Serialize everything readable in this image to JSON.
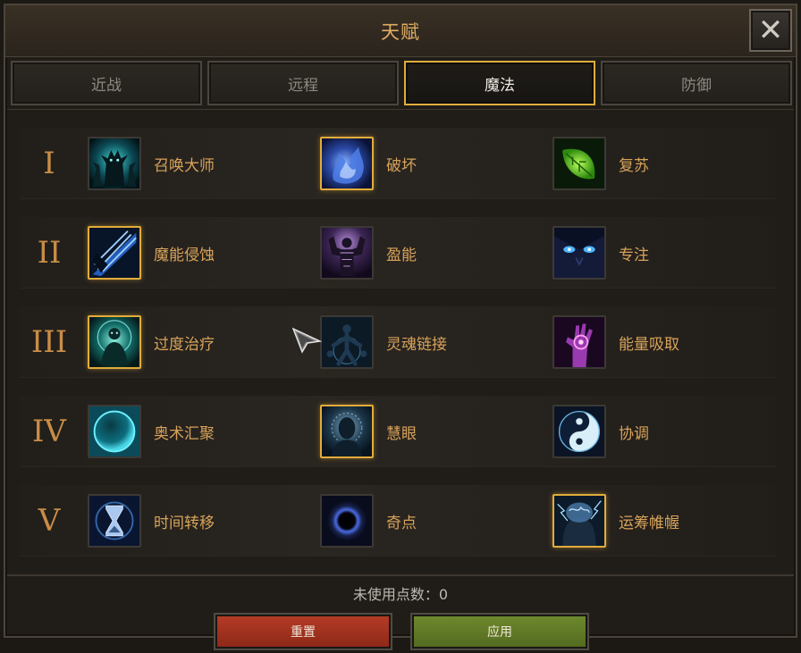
{
  "window": {
    "title": "天赋",
    "close_icon": "close-icon"
  },
  "tabs": [
    {
      "label": "近战",
      "active": false
    },
    {
      "label": "远程",
      "active": false
    },
    {
      "label": "魔法",
      "active": true
    },
    {
      "label": "防御",
      "active": false
    }
  ],
  "tiers": [
    {
      "label": "I",
      "talents": [
        {
          "name": "召唤大师",
          "icon": "demon-summon-icon",
          "selected": false
        },
        {
          "name": "破坏",
          "icon": "blue-flame-icon",
          "selected": true
        },
        {
          "name": "复苏",
          "icon": "green-leaf-icon",
          "selected": false
        }
      ]
    },
    {
      "label": "II",
      "talents": [
        {
          "name": "魔能侵蚀",
          "icon": "arcane-slash-icon",
          "selected": true
        },
        {
          "name": "盈能",
          "icon": "flexing-figure-icon",
          "selected": false
        },
        {
          "name": "专注",
          "icon": "glowing-eyes-icon",
          "selected": false
        }
      ]
    },
    {
      "label": "III",
      "talents": [
        {
          "name": "过度治疗",
          "icon": "healing-aura-icon",
          "selected": true
        },
        {
          "name": "灵魂链接",
          "icon": "soul-link-icon",
          "selected": false
        },
        {
          "name": "能量吸取",
          "icon": "drain-hand-icon",
          "selected": false
        }
      ]
    },
    {
      "label": "IV",
      "talents": [
        {
          "name": "奥术汇聚",
          "icon": "arcane-orb-icon",
          "selected": false
        },
        {
          "name": "慧眼",
          "icon": "enlightened-head-icon",
          "selected": true
        },
        {
          "name": "协调",
          "icon": "yin-yang-icon",
          "selected": false
        }
      ]
    },
    {
      "label": "V",
      "talents": [
        {
          "name": "时间转移",
          "icon": "hourglass-icon",
          "selected": false
        },
        {
          "name": "奇点",
          "icon": "black-hole-icon",
          "selected": false
        },
        {
          "name": "运筹帷幄",
          "icon": "brain-storm-icon",
          "selected": true
        }
      ]
    }
  ],
  "footer": {
    "points_label": "未使用点数：0",
    "reset_label": "重置",
    "apply_label": "应用"
  },
  "colors": {
    "accent_gold": "#e2ac3a",
    "reset_red": "#b63c27",
    "apply_green": "#6f8a2e"
  }
}
